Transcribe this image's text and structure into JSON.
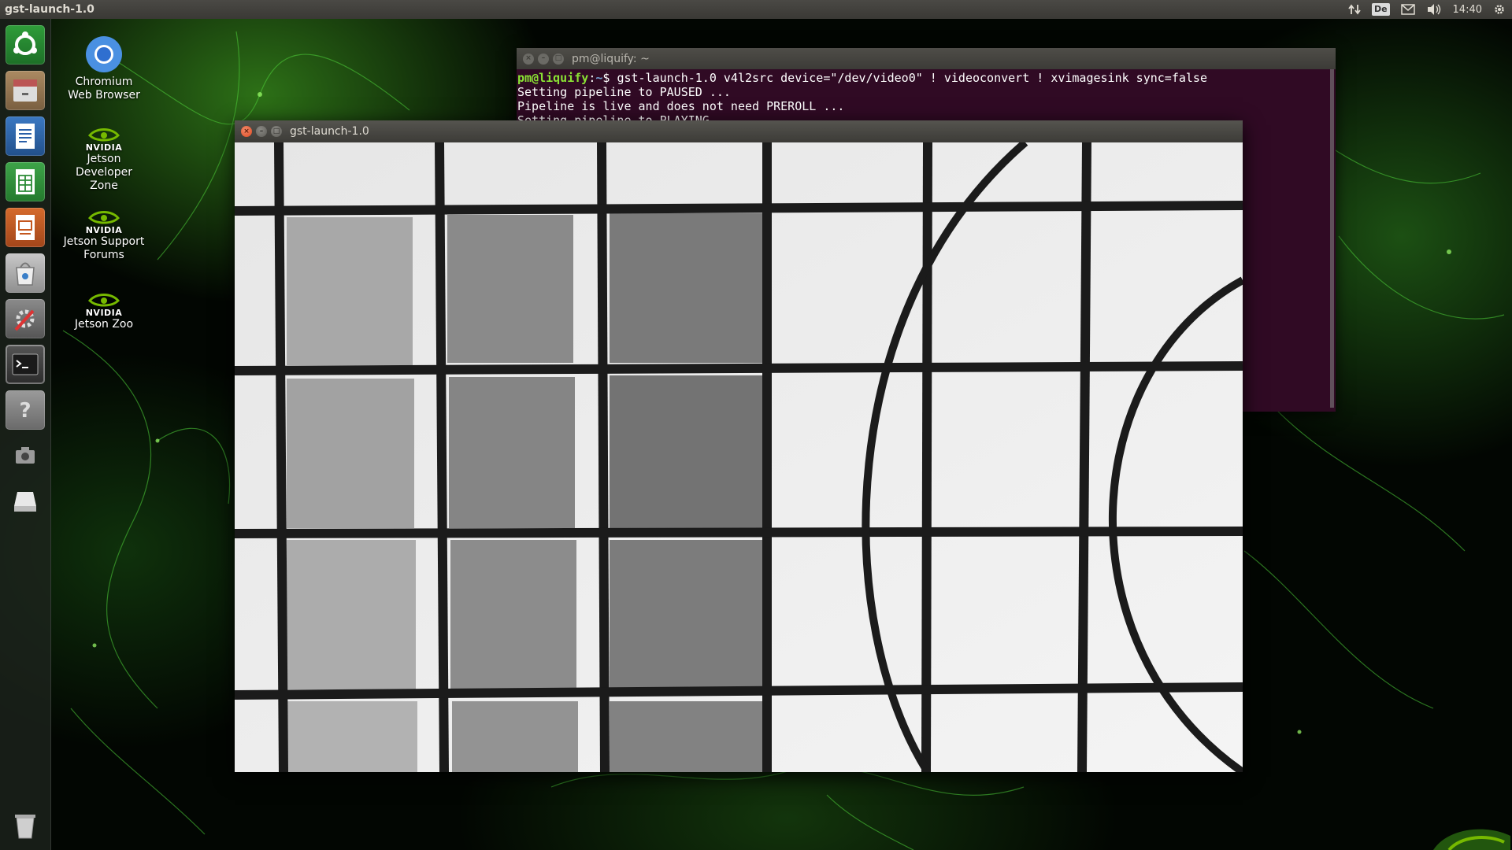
{
  "top_panel": {
    "app_title": "gst-launch-1.0",
    "keyboard_layout": "De",
    "clock": "14:40"
  },
  "launcher": {
    "items": [
      "dash-home",
      "file-manager",
      "libreoffice-writer",
      "libreoffice-calc",
      "libreoffice-impress",
      "software-center",
      "system-settings",
      "terminal",
      "help",
      "camera",
      "removable-drive",
      "trash"
    ]
  },
  "desktop": {
    "icons": [
      {
        "label": "Chromium Web Browser",
        "icon": "chromium-icon"
      },
      {
        "label": "Jetson Developer Zone",
        "brand": "NVIDIA",
        "icon": "nvidia-icon"
      },
      {
        "label": "Jetson Support Forums",
        "brand": "NVIDIA",
        "icon": "nvidia-icon"
      },
      {
        "label": "Jetson Zoo",
        "brand": "NVIDIA",
        "icon": "nvidia-icon"
      }
    ]
  },
  "terminal": {
    "title": "pm@liquify: ~",
    "prompt_user": "pm@liquify",
    "prompt_sep": ":",
    "prompt_path": "~",
    "prompt_symbol": "$ ",
    "command": "gst-launch-1.0 v4l2src device=\"/dev/video0\" ! videoconvert ! xvimagesink sync=false",
    "output": [
      "Setting pipeline to PAUSED ...",
      "Pipeline is live and does not need PREROLL ...",
      "Setting pipeline to PLAYING ..."
    ]
  },
  "video_window": {
    "title": "gst-launch-1.0",
    "content": "live camera feed of a printed calibration chart"
  },
  "colors": {
    "terminal_bg": "#300a24",
    "prompt_user": "#8ae234",
    "prompt_path": "#729fcf",
    "close_button": "#dd4a22",
    "nvidia_green": "#76b900"
  }
}
